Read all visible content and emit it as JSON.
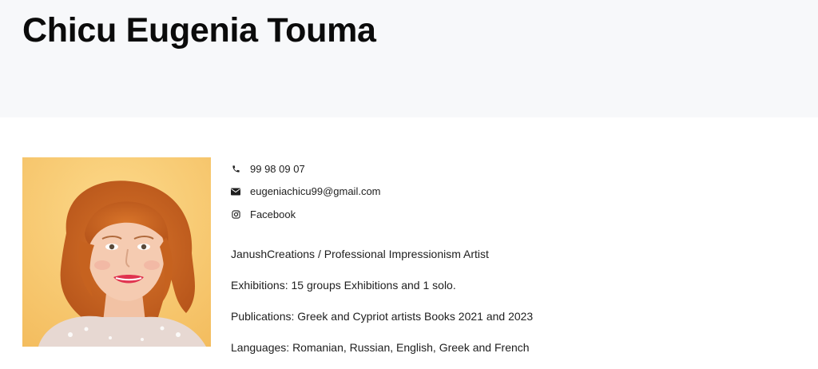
{
  "profile": {
    "name": "Chicu Eugenia Touma"
  },
  "contact": {
    "phone": "99 98 09 07",
    "email": "eugeniachicu99@gmail.com",
    "social": "Facebook"
  },
  "bio": {
    "lines": [
      "JanushCreations / Professional Impressionism Artist",
      "Exhibitions: 15 groups Exhibitions and 1 solo.",
      "Publications: Greek and Cypriot artists Books 2021 and 2023",
      "Languages: Romanian, Russian, English, Greek and French"
    ]
  },
  "icons": {
    "phone": "phone-icon",
    "email": "envelope-icon",
    "social": "instagram-icon"
  }
}
